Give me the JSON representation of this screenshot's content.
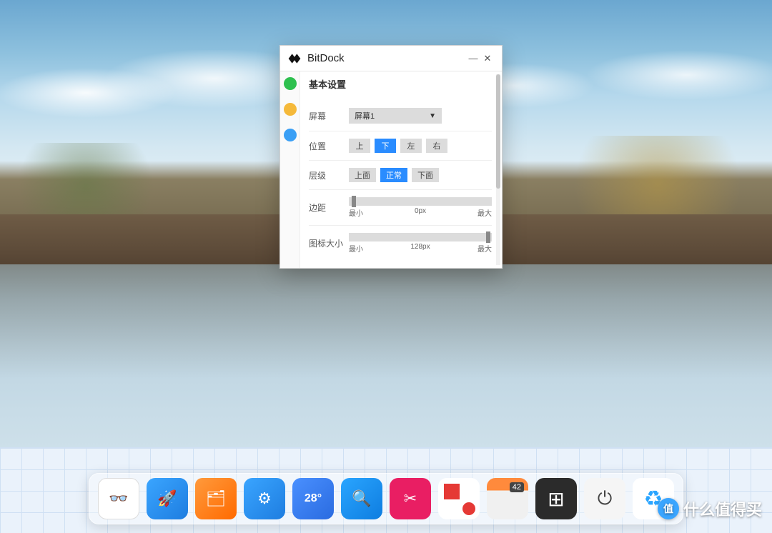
{
  "window": {
    "title": "BitDock",
    "section_title": "基本设置",
    "rows": {
      "screen": {
        "label": "屏幕",
        "selected": "屏幕1"
      },
      "position": {
        "label": "位置",
        "options": {
          "up": "上",
          "down": "下",
          "left": "左",
          "right": "右"
        },
        "active": "down"
      },
      "layer": {
        "label": "层级",
        "options": {
          "top": "上面",
          "normal": "正常",
          "bottom": "下面"
        },
        "active": "normal"
      },
      "margin": {
        "label": "边距",
        "min": "最小",
        "value": "0px",
        "max": "最大",
        "thumb_pct": 2
      },
      "icon_size": {
        "label": "图标大小",
        "min": "最小",
        "value": "128px",
        "max": "最大",
        "thumb_pct": 96
      }
    }
  },
  "dock": {
    "items": [
      {
        "name": "geek-app",
        "glyph": "👓"
      },
      {
        "name": "rocket-app",
        "glyph": "🚀"
      },
      {
        "name": "files-app",
        "glyph": "🗂"
      },
      {
        "name": "settings-app",
        "glyph": "⚙"
      },
      {
        "name": "weather-app",
        "glyph": "28°"
      },
      {
        "name": "search-app",
        "glyph": "🔍"
      },
      {
        "name": "crop-app",
        "glyph": "✂"
      },
      {
        "name": "recorder-app",
        "glyph": ""
      },
      {
        "name": "calendar-app",
        "glyph": "",
        "badge": "42"
      },
      {
        "name": "windows-app",
        "glyph": "⊞"
      },
      {
        "name": "power-app",
        "glyph": "⏻"
      },
      {
        "name": "recycle-app",
        "glyph": "♻"
      }
    ]
  },
  "watermark": {
    "badge": "值",
    "text": "什么值得买"
  }
}
